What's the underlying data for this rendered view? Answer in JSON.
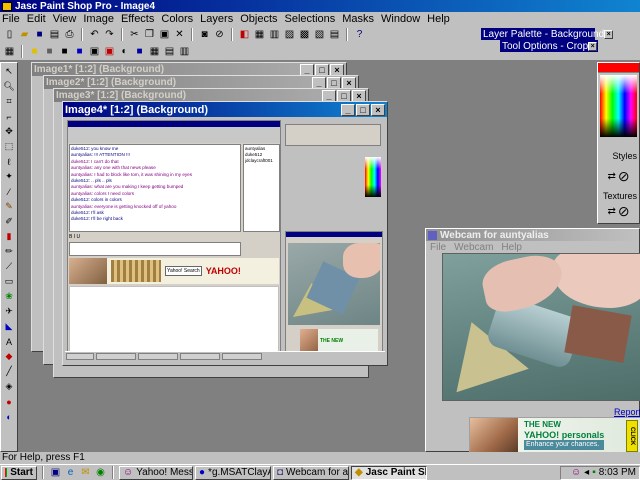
{
  "app": {
    "title": "Jasc Paint Shop Pro - Image4",
    "menus": [
      "File",
      "Edit",
      "View",
      "Image",
      "Effects",
      "Colors",
      "Layers",
      "Objects",
      "Selections",
      "Masks",
      "Window",
      "Help"
    ]
  },
  "palettes": {
    "layer": "Layer Palette - Background",
    "tool_options": "Tool Options - Crop",
    "styles_label": "Styles",
    "textures_label": "Textures"
  },
  "windows": {
    "image1": "Image1* [1:2] (Background)",
    "image2": "Image2* [1:2] (Background)",
    "image3": "Image3* [1:2] (Background)",
    "image4": "Image4* [1:2] (Background)"
  },
  "chat": {
    "lines": [
      {
        "text": "duke512: you know me",
        "color": "#000080"
      },
      {
        "text": "auntyalias: !!! ATTENTION !!!",
        "color": "#000080"
      },
      {
        "text": "duke512: I can't do that",
        "color": "#800080"
      },
      {
        "text": "auntyalias: any one with that news  please",
        "color": "#800080"
      },
      {
        "text": "auntyalias: I had to block like tom, it was shining in my eyes",
        "color": "#800080"
      },
      {
        "text": "duke512: .. pls .. pls",
        "color": "#000080"
      },
      {
        "text": "auntyalias: what are you making I keep getting bumped",
        "color": "#800080"
      },
      {
        "text": "auntyalias: colors I need colors",
        "color": "#800080"
      },
      {
        "text": "duke512: colors in colors",
        "color": "#000080"
      },
      {
        "text": "auntyalias: everyone is getting knocked off of yahoo",
        "color": "#800080"
      },
      {
        "text": "duke512: I'll ask",
        "color": "#000080"
      },
      {
        "text": "duke512: I'll be right back",
        "color": "#000080"
      }
    ],
    "users": [
      "auntyalias",
      "duke512",
      "jdclaycraft001"
    ]
  },
  "ads": {
    "the_new": "THE NEW",
    "yahoo": "YAHOO!",
    "personals": "personals",
    "tagline": "Enhance your chances.",
    "click": "CLICK",
    "yahoo_search": "Yahoo! Search"
  },
  "webcam": {
    "title": "Webcam for auntyalias",
    "menus": [
      "File",
      "Webcam",
      "Help"
    ],
    "report": "Report Al"
  },
  "status": "For Help, press F1",
  "taskbar": {
    "start": "Start",
    "tasks": [
      "Yahoo! Messenger",
      "*g.MSATClayArt...",
      "Webcam for aunt...",
      "Jasc Paint Sh..."
    ],
    "time": "8:03 PM"
  },
  "colors": {
    "title_active": "#000080",
    "desktop": "#808080"
  }
}
